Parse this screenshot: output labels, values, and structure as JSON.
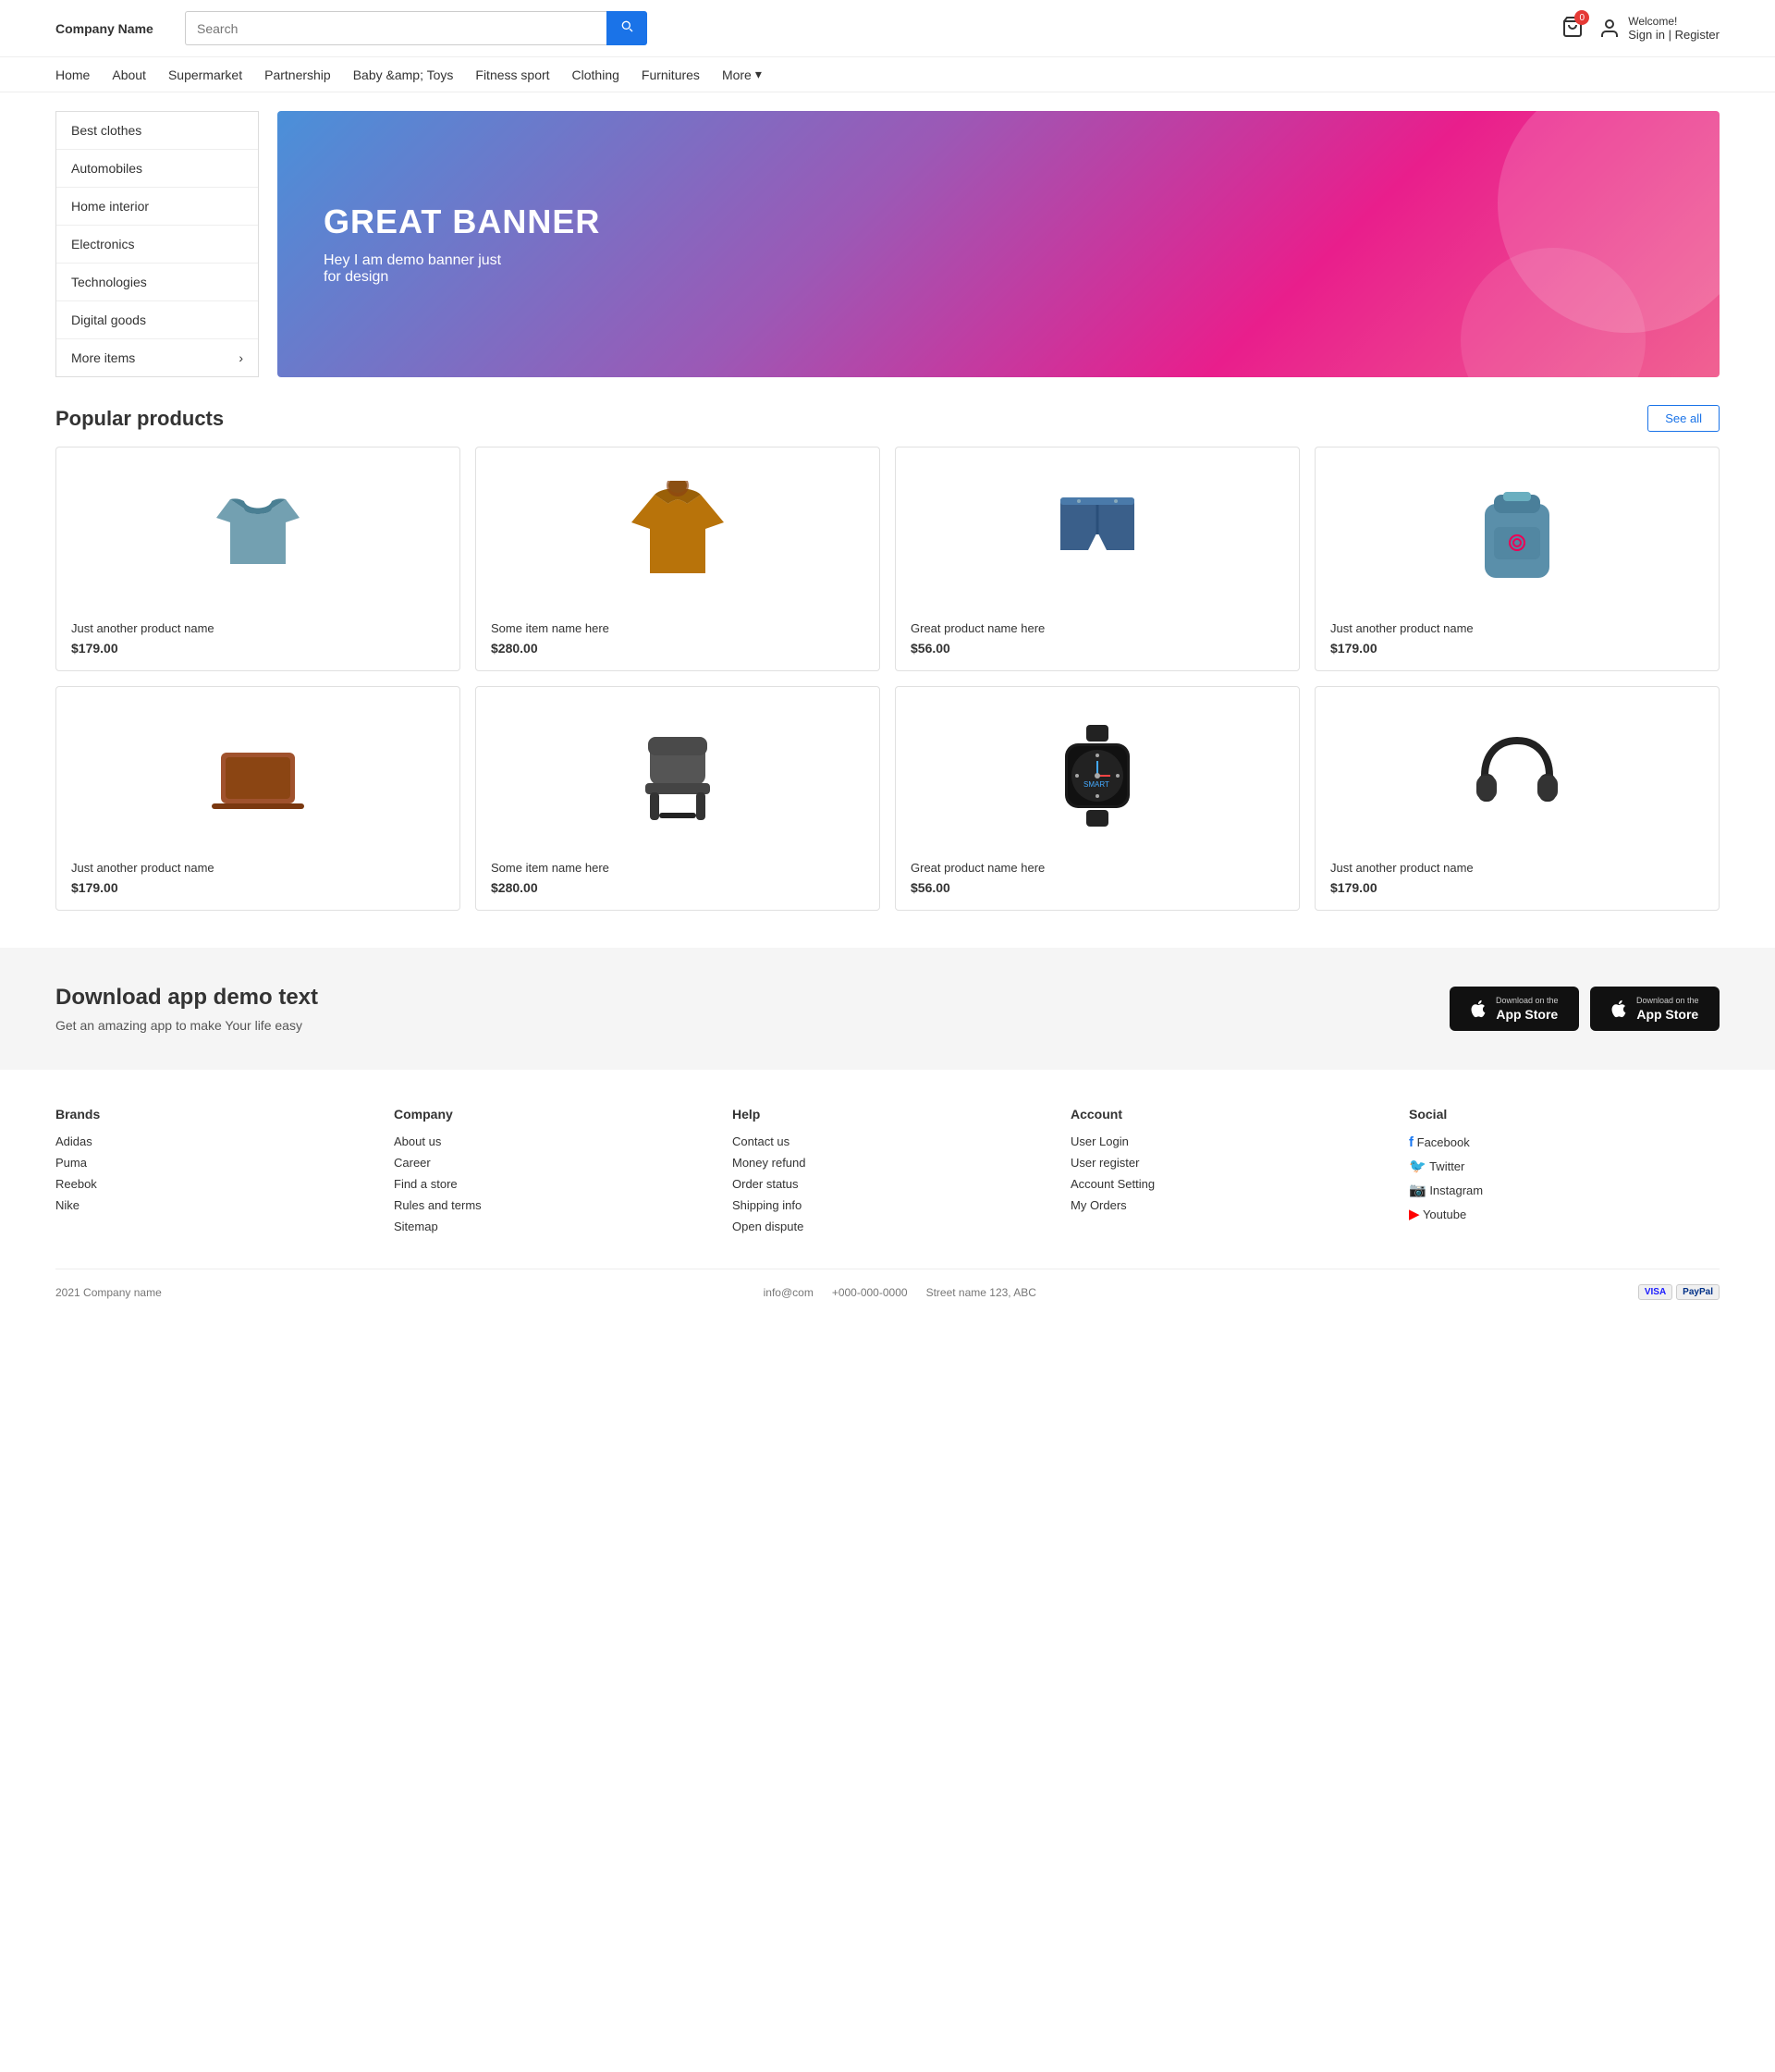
{
  "header": {
    "logo": "Company Name",
    "search_placeholder": "Search",
    "search_btn_icon": "🔍",
    "cart_count": "0",
    "welcome_greeting": "Welcome!",
    "sign_label": "Sign in | Register"
  },
  "navbar": {
    "items": [
      {
        "label": "Home",
        "id": "nav-home"
      },
      {
        "label": "About",
        "id": "nav-about"
      },
      {
        "label": "Supermarket",
        "id": "nav-supermarket"
      },
      {
        "label": "Partnership",
        "id": "nav-partnership"
      },
      {
        "label": "Baby &amp; Toys",
        "id": "nav-baby"
      },
      {
        "label": "Fitness sport",
        "id": "nav-fitness"
      },
      {
        "label": "Clothing",
        "id": "nav-clothing"
      },
      {
        "label": "Furnitures",
        "id": "nav-furnitures"
      },
      {
        "label": "More",
        "id": "nav-more"
      }
    ]
  },
  "sidebar": {
    "items": [
      {
        "label": "Best clothes"
      },
      {
        "label": "Automobiles"
      },
      {
        "label": "Home interior"
      },
      {
        "label": "Electronics"
      },
      {
        "label": "Technologies"
      },
      {
        "label": "Digital goods"
      },
      {
        "label": "More items"
      }
    ]
  },
  "banner": {
    "title": "GREAT BANNER",
    "subtitle": "Hey I am demo banner just\nfor design"
  },
  "popular_products": {
    "section_title": "Popular products",
    "see_all_label": "See all",
    "products": [
      {
        "name": "Just another product name",
        "price": "$179.00",
        "type": "shirt"
      },
      {
        "name": "Some item name here",
        "price": "$280.00",
        "type": "jacket"
      },
      {
        "name": "Great product name here",
        "price": "$56.00",
        "type": "shorts"
      },
      {
        "name": "Just another product name",
        "price": "$179.00",
        "type": "backpack"
      },
      {
        "name": "Just another product name",
        "price": "$179.00",
        "type": "laptop"
      },
      {
        "name": "Some item name here",
        "price": "$280.00",
        "type": "chair"
      },
      {
        "name": "Great product name here",
        "price": "$56.00",
        "type": "watch"
      },
      {
        "name": "Just another product name",
        "price": "$179.00",
        "type": "headphones"
      }
    ]
  },
  "app_section": {
    "title": "Download app demo text",
    "subtitle": "Get an amazing app to make Your life easy",
    "btn1_small": "Download on the",
    "btn1_large": "App Store",
    "btn2_small": "Download on the",
    "btn2_large": "App Store"
  },
  "footer": {
    "brands": {
      "heading": "Brands",
      "links": [
        "Adidas",
        "Puma",
        "Reebok",
        "Nike"
      ]
    },
    "company": {
      "heading": "Company",
      "links": [
        "About us",
        "Career",
        "Find a store",
        "Rules and terms",
        "Sitemap"
      ]
    },
    "help": {
      "heading": "Help",
      "links": [
        "Contact us",
        "Money refund",
        "Order status",
        "Shipping info",
        "Open dispute"
      ]
    },
    "account": {
      "heading": "Account",
      "links": [
        "User Login",
        "User register",
        "Account Setting",
        "My Orders"
      ]
    },
    "social": {
      "heading": "Social",
      "links": [
        {
          "label": "Facebook",
          "icon": "fb"
        },
        {
          "label": "Twitter",
          "icon": "tw"
        },
        {
          "label": "Instagram",
          "icon": "ig"
        },
        {
          "label": "Youtube",
          "icon": "yt"
        }
      ]
    },
    "bottom": {
      "copyright": "2021 Company name",
      "email": "info@com",
      "phone": "+000-000-0000",
      "address": "Street name 123, ABC"
    }
  }
}
